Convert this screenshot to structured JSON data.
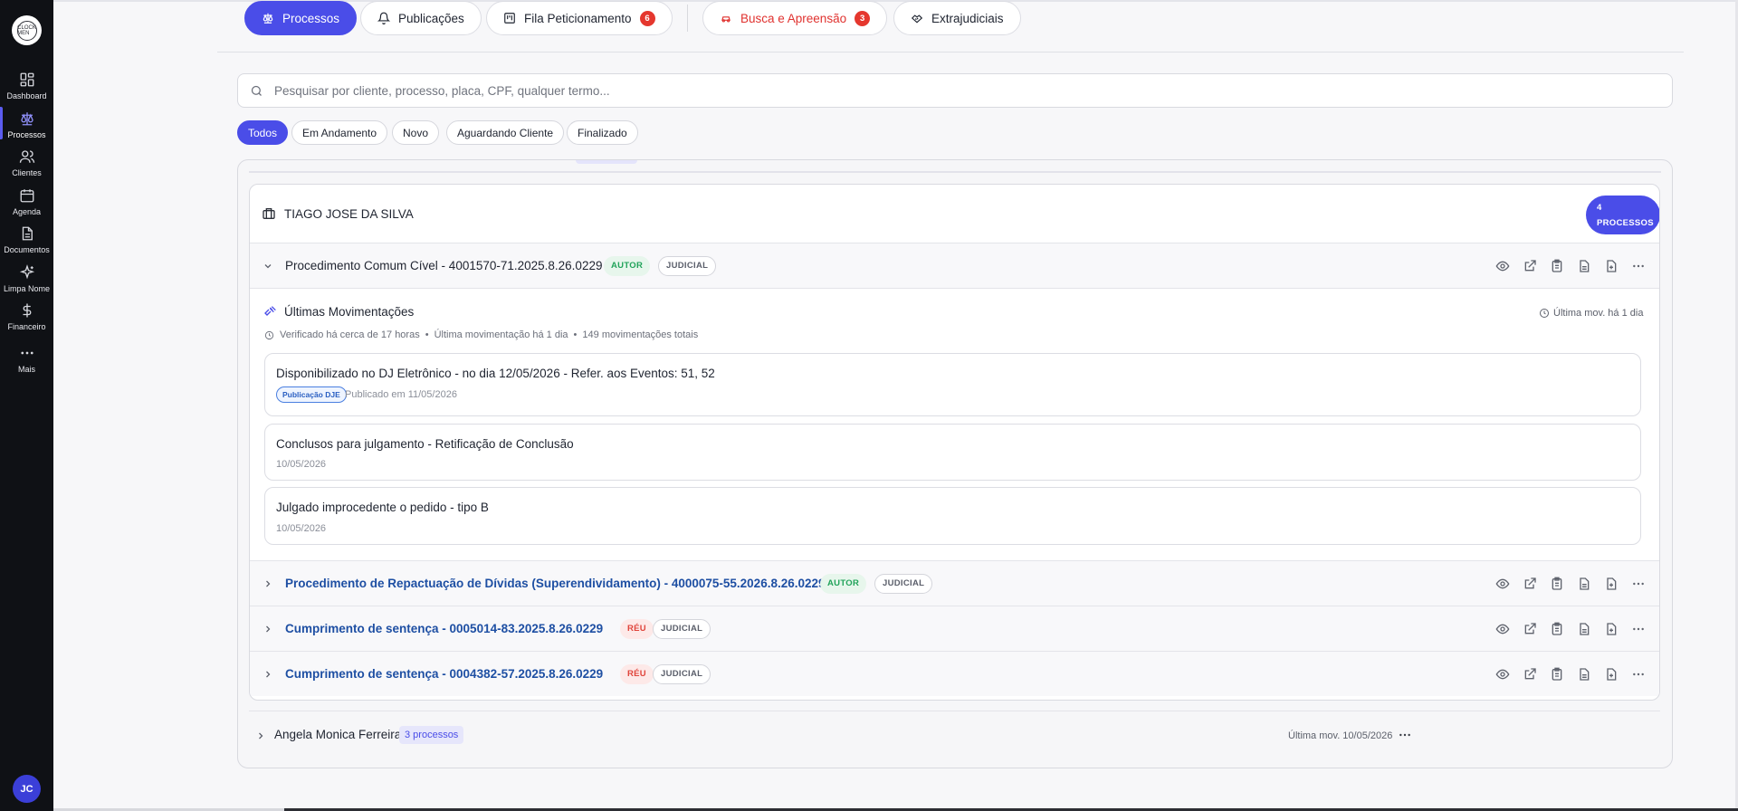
{
  "sidebar": {
    "logo_text": "CLOCK MEN",
    "items": [
      {
        "label": "Dashboard",
        "icon": "dashboard-icon"
      },
      {
        "label": "Processos",
        "icon": "scale-icon",
        "active": true
      },
      {
        "label": "Clientes",
        "icon": "users-icon"
      },
      {
        "label": "Agenda",
        "icon": "calendar-icon"
      },
      {
        "label": "Documentos",
        "icon": "document-icon"
      },
      {
        "label": "Limpa Nome",
        "icon": "sparkles-icon"
      },
      {
        "label": "Financeiro",
        "icon": "dollar-icon"
      },
      {
        "label": "Mais",
        "icon": "more-icon"
      }
    ],
    "avatar": "JC"
  },
  "tabs": [
    {
      "label": "Processos",
      "active": true
    },
    {
      "label": "Publicações"
    },
    {
      "label": "Fila Peticionamento",
      "badge": "6"
    },
    {
      "label": "Busca e Apreensão",
      "badge": "3"
    },
    {
      "label": "Extrajudiciais"
    }
  ],
  "search": {
    "placeholder": "Pesquisar por cliente, processo, placa, CPF, qualquer termo..."
  },
  "filters": [
    "Todos",
    "Em Andamento",
    "Novo",
    "Aguardando Cliente",
    "Finalizado"
  ],
  "client": {
    "name": "TIAGO JOSE DA SILVA",
    "count_line1": "4",
    "count_line2": "PROCESSOS",
    "processes": [
      {
        "title": "Procedimento Comum Cível - 4001570-71.2025.8.26.0229",
        "role": "AUTOR",
        "type": "JUDICIAL",
        "expanded": true
      },
      {
        "title": "Procedimento de Repactuação de Dívidas (Superendividamento) - 4000075-55.2026.8.26.0229",
        "role": "AUTOR",
        "type": "JUDICIAL"
      },
      {
        "title": "Cumprimento de sentença - 0005014-83.2025.8.26.0229",
        "role": "RÉU",
        "type": "JUDICIAL"
      },
      {
        "title": "Cumprimento de sentença - 0004382-57.2025.8.26.0229",
        "role": "RÉU",
        "type": "JUDICIAL"
      }
    ],
    "movements": {
      "title": "Últimas Movimentações",
      "last": "Última mov. há 1 dia",
      "meta_verified": "Verificado há cerca de 17 horas",
      "meta_last": "Última movimentação há 1 dia",
      "meta_total": "149 movimentações totais",
      "items": [
        {
          "title": "Disponibilizado no DJ Eletrônico - no dia 12/05/2026 - Refer. aos Eventos: 51, 52",
          "tag": "Publicação DJE",
          "date": "Publicado em 11/05/2026"
        },
        {
          "title": "Conclusos para julgamento - Retificação de Conclusão",
          "date": "10/05/2026"
        },
        {
          "title": "Julgado improcedente o pedido - tipo B",
          "date": "10/05/2026"
        }
      ]
    }
  },
  "other_client": {
    "name": "Angela Monica Ferreira",
    "count": "3 processos",
    "last": "Última mov. 10/05/2026"
  },
  "colors": {
    "accent": "#4a4de8",
    "danger": "#e0322f",
    "success": "#21a35a",
    "link": "#1e4fa3"
  }
}
